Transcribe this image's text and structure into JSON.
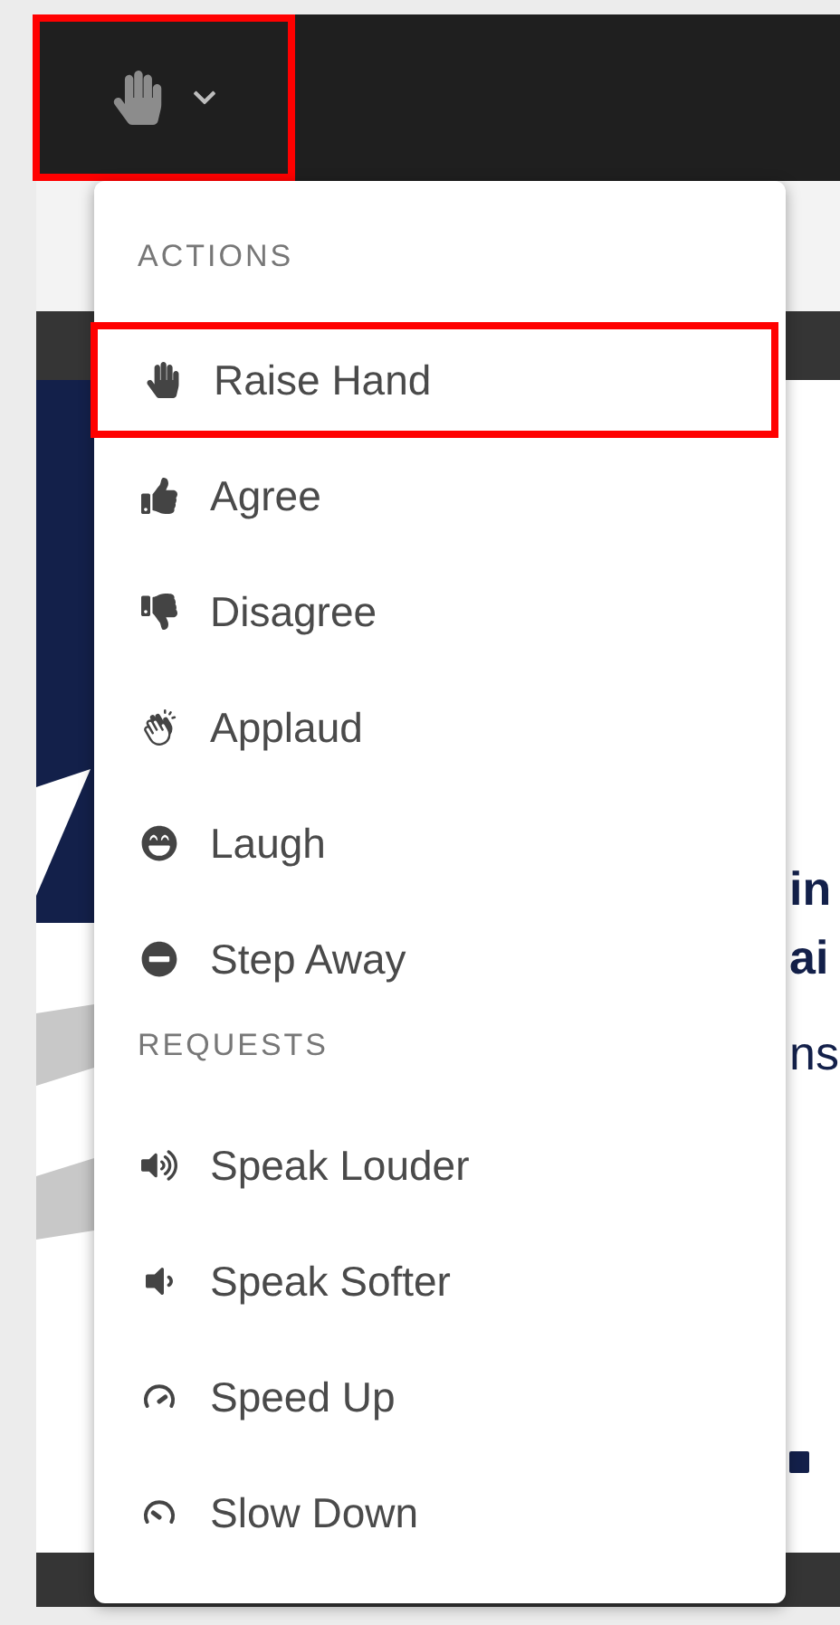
{
  "toolbar": {
    "button": {
      "highlighted": true,
      "expanded": true
    }
  },
  "slide": {
    "fragments": [
      {
        "text": "in",
        "kind": "heading"
      },
      {
        "text": "ai",
        "kind": "heading"
      },
      {
        "text": "ns",
        "kind": "body"
      }
    ]
  },
  "menu": {
    "sections": [
      {
        "title": "ACTIONS",
        "items": [
          {
            "label": "Raise Hand",
            "kind": "hand",
            "selected": true
          },
          {
            "label": "Agree",
            "kind": "thumbs-up",
            "selected": false
          },
          {
            "label": "Disagree",
            "kind": "thumbs-down",
            "selected": false
          },
          {
            "label": "Applaud",
            "kind": "clap",
            "selected": false
          },
          {
            "label": "Laugh",
            "kind": "laugh",
            "selected": false
          },
          {
            "label": "Step Away",
            "kind": "away",
            "selected": false
          }
        ]
      },
      {
        "title": "REQUESTS",
        "items": [
          {
            "label": "Speak Louder",
            "kind": "louder",
            "selected": false
          },
          {
            "label": "Speak Softer",
            "kind": "softer",
            "selected": false
          },
          {
            "label": "Speed Up",
            "kind": "faster",
            "selected": false
          },
          {
            "label": "Slow Down",
            "kind": "slower",
            "selected": false
          }
        ]
      }
    ]
  }
}
